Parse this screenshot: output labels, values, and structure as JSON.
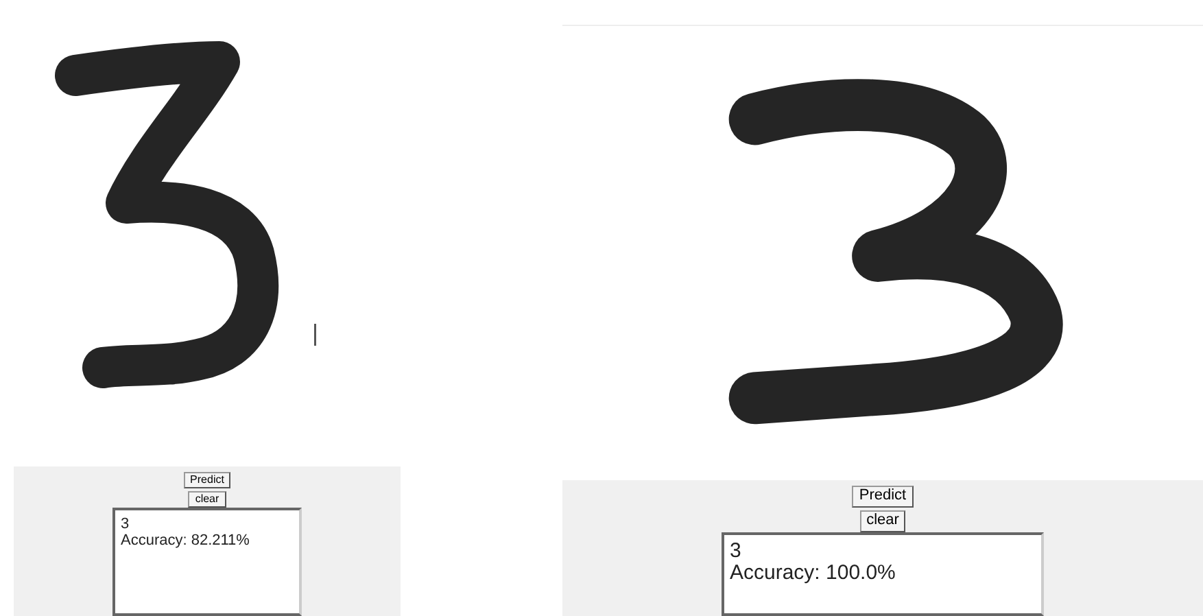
{
  "panels": [
    {
      "predict_button": "Predict",
      "clear_button": "clear",
      "result_lines": [
        "3",
        "Accuracy: 82.211%"
      ]
    },
    {
      "predict_button": "Predict",
      "clear_button": "clear",
      "result_lines": [
        "3",
        "Accuracy: 100.0%"
      ]
    }
  ]
}
